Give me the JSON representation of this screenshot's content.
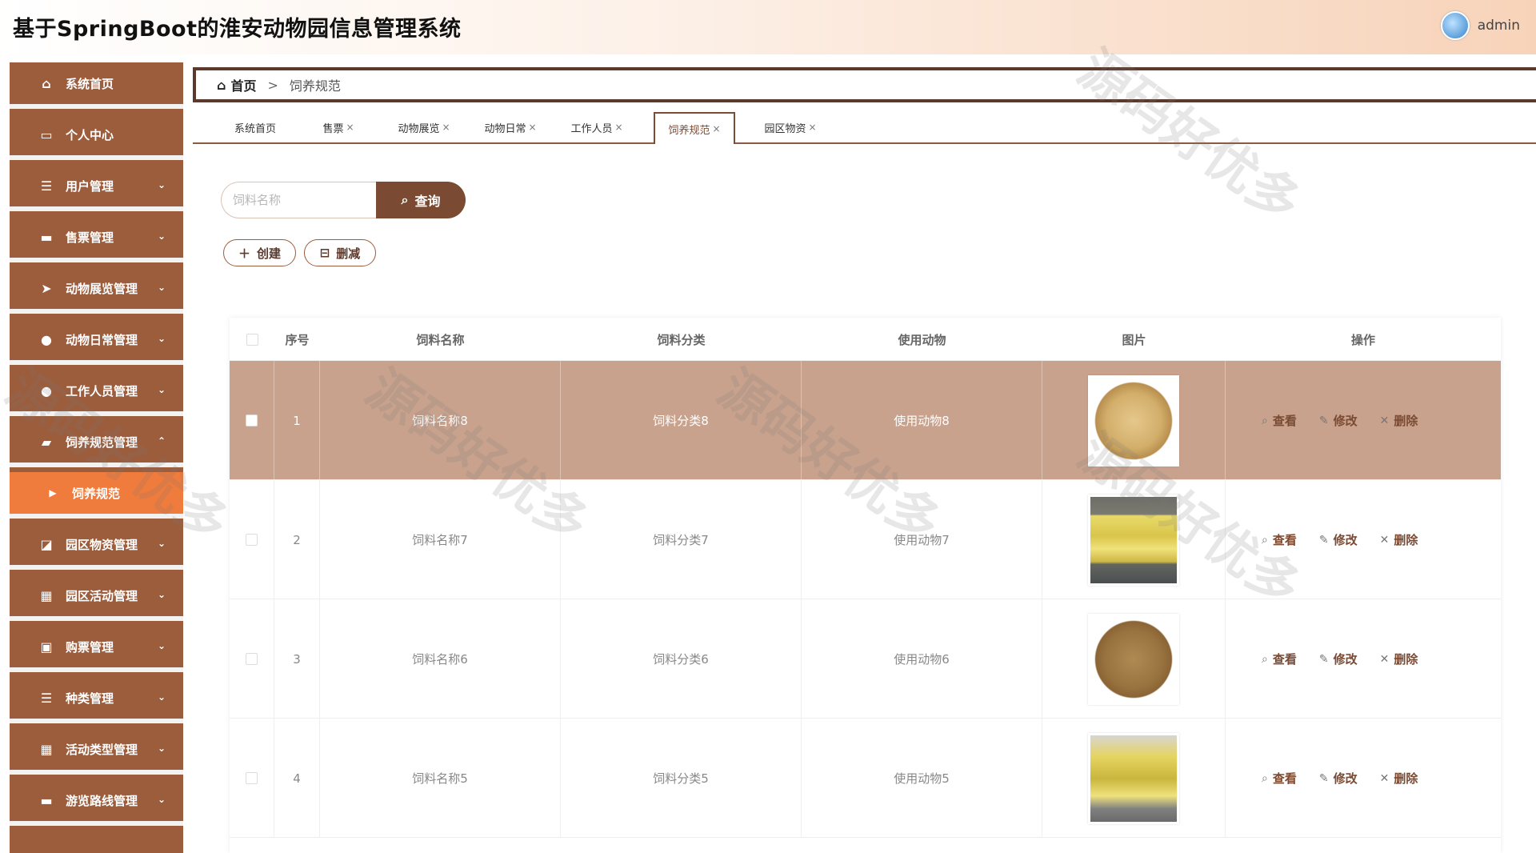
{
  "header": {
    "title": "基于SpringBoot的淮安动物园信息管理系统",
    "username": "admin"
  },
  "sidebar": {
    "items": [
      {
        "label": "系统首页",
        "icon": "home-icon"
      },
      {
        "label": "个人中心",
        "icon": "profile-card-icon"
      },
      {
        "label": "用户管理",
        "icon": "list-icon"
      },
      {
        "label": "售票管理",
        "icon": "ticket-icon"
      },
      {
        "label": "动物展览管理",
        "icon": "send-icon"
      },
      {
        "label": "动物日常管理",
        "icon": "person-icon"
      },
      {
        "label": "工作人员管理",
        "icon": "person-icon"
      },
      {
        "label": "饲养规范管理",
        "icon": "chat-icon"
      },
      {
        "label": "饲养规范",
        "icon": "caret-right-icon"
      },
      {
        "label": "园区物资管理",
        "icon": "chart-icon"
      },
      {
        "label": "园区活动管理",
        "icon": "grid-icon"
      },
      {
        "label": "购票管理",
        "icon": "monitor-icon"
      },
      {
        "label": "种类管理",
        "icon": "list-icon"
      },
      {
        "label": "活动类型管理",
        "icon": "grid-icon"
      },
      {
        "label": "游览路线管理",
        "icon": "card-icon"
      }
    ]
  },
  "breadcrumb": {
    "home": "首页",
    "separator": ">",
    "current": "饲养规范"
  },
  "tabs": [
    {
      "label": "系统首页",
      "closable": false
    },
    {
      "label": "售票",
      "closable": true
    },
    {
      "label": "动物展览",
      "closable": true
    },
    {
      "label": "动物日常",
      "closable": true
    },
    {
      "label": "工作人员",
      "closable": true
    },
    {
      "label": "饲养规范",
      "closable": true
    },
    {
      "label": "园区物资",
      "closable": true
    }
  ],
  "tab_close": "×",
  "search": {
    "placeholder": "饲料名称",
    "button": "查询"
  },
  "actions": {
    "create": "创建",
    "delete": "删减"
  },
  "table": {
    "columns": [
      "序号",
      "饲料名称",
      "饲料分类",
      "使用动物",
      "图片",
      "操作"
    ],
    "rows": [
      {
        "index": "1",
        "name": "饲料名称8",
        "category": "饲料分类8",
        "animal": "使用动物8",
        "image": "grain"
      },
      {
        "index": "2",
        "name": "饲料名称7",
        "category": "饲料分类7",
        "animal": "使用动物7",
        "image": "bags-yellow"
      },
      {
        "index": "3",
        "name": "饲料名称6",
        "category": "饲料分类6",
        "animal": "使用动物6",
        "image": "pellets"
      },
      {
        "index": "4",
        "name": "饲料名称5",
        "category": "饲料分类5",
        "animal": "使用动物5",
        "image": "bags-stack"
      }
    ],
    "ops": {
      "view": "查看",
      "edit": "修改",
      "remove": "删除"
    }
  },
  "watermark": "源码好优多",
  "colors": {
    "sidebar": "#9c5d3d",
    "active_menu": "#ef7b3c",
    "primary_button": "#7b4a33",
    "highlight_row": "#c8a28d"
  }
}
